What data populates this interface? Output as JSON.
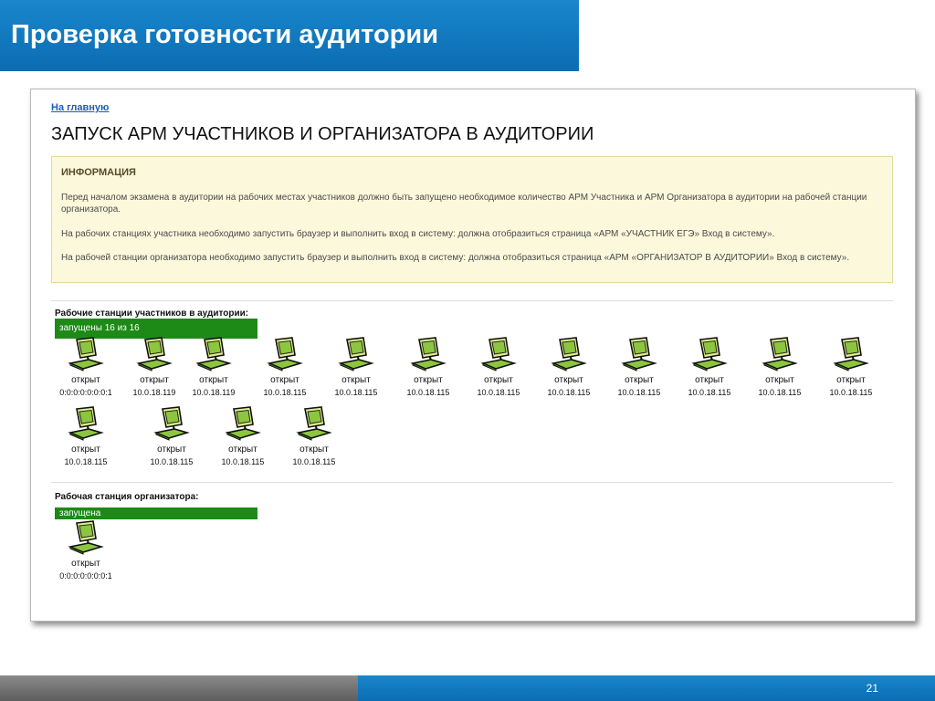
{
  "slide": {
    "title": "Проверка готовности аудитории",
    "page_number": "21"
  },
  "page": {
    "home_link": "На главную",
    "heading": "ЗАПУСК АРМ УЧАСТНИКОВ И ОРГАНИЗАТОРА В АУДИТОРИИ",
    "info": {
      "title": "ИНФОРМАЦИЯ",
      "p1": "Перед началом экзамена в аудитории на рабочих местах участников должно быть запущено необходимое количество АРМ Участника и АРМ Организатора в аудитории на рабочей станции организатора.",
      "p2": "На рабочих станциях участника необходимо запустить браузер и выполнить вход в систему: должна отобразиться страница «АРМ «УЧАСТНИК ЕГЭ» Вход в систему».",
      "p3": "На рабочей станции организатора необходимо запустить браузер и выполнить вход в систему: должна отобразиться страница «АРМ «ОРГАНИЗАТОР В АУДИТОРИИ» Вход в систему»."
    },
    "participants": {
      "label": "Рабочие станции участников в аудитории:",
      "status": "запущены 16 из 16",
      "stations": [
        {
          "status": "открыт",
          "ip": "0:0:0:0:0:0:0:1"
        },
        {
          "status": "открыт",
          "ip": "10.0.18.119"
        },
        {
          "status": "открыт",
          "ip": "10.0.18.119"
        },
        {
          "status": "открыт",
          "ip": "10.0.18.115"
        },
        {
          "status": "открыт",
          "ip": "10.0.18.115"
        },
        {
          "status": "открыт",
          "ip": "10.0.18.115"
        },
        {
          "status": "открыт",
          "ip": "10.0.18.115"
        },
        {
          "status": "открыт",
          "ip": "10.0.18.115"
        },
        {
          "status": "открыт",
          "ip": "10.0.18.115"
        },
        {
          "status": "открыт",
          "ip": "10.0.18.115"
        },
        {
          "status": "открыт",
          "ip": "10.0.18.115"
        },
        {
          "status": "открыт",
          "ip": "10.0.18.115"
        },
        {
          "status": "открыт",
          "ip": "10.0.18.115"
        },
        {
          "status": "открыт",
          "ip": "10.0.18.115"
        },
        {
          "status": "открыт",
          "ip": "10.0.18.115"
        },
        {
          "status": "открыт",
          "ip": "10.0.18.115"
        }
      ]
    },
    "organizer": {
      "label": "Рабочая станция организатора:",
      "status": "запущена",
      "station": {
        "status": "открыт",
        "ip": "0:0:0:0:0:0:0:1"
      }
    }
  },
  "colors": {
    "header_blue": "#0b6db3",
    "status_green": "#1d8a17",
    "link_blue": "#1a5fb4",
    "info_bg": "#fcf8dc"
  },
  "icons": {
    "station": "computer-icon"
  }
}
